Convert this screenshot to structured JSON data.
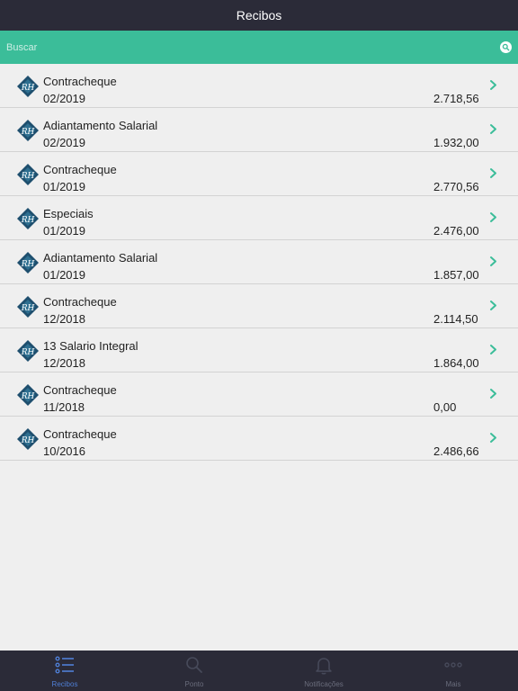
{
  "header": {
    "title": "Recibos"
  },
  "search": {
    "placeholder": "Buscar"
  },
  "receipts": [
    {
      "title": "Contracheque",
      "date": "02/2019",
      "value": "2.718,56"
    },
    {
      "title": "Adiantamento Salarial",
      "date": "02/2019",
      "value": "1.932,00"
    },
    {
      "title": "Contracheque",
      "date": "01/2019",
      "value": "2.770,56"
    },
    {
      "title": "Especiais",
      "date": "01/2019",
      "value": "2.476,00"
    },
    {
      "title": "Adiantamento Salarial",
      "date": "01/2019",
      "value": "1.857,00"
    },
    {
      "title": "Contracheque",
      "date": "12/2018",
      "value": "2.114,50"
    },
    {
      "title": "13 Salario Integral",
      "date": "12/2018",
      "value": "1.864,00"
    },
    {
      "title": "Contracheque",
      "date": "11/2018",
      "value": "0,00"
    },
    {
      "title": "Contracheque",
      "date": "10/2016",
      "value": "2.486,66"
    }
  ],
  "tabs": [
    {
      "label": "Recibos",
      "icon": "list-icon",
      "active": true
    },
    {
      "label": "Ponto",
      "icon": "search-icon",
      "active": false
    },
    {
      "label": "Notificações",
      "icon": "bell-icon",
      "active": false
    },
    {
      "label": "Mais",
      "icon": "more-icon",
      "active": false
    }
  ],
  "colors": {
    "nav_background": "#2b2b38",
    "search_background": "#3bbd99",
    "accent": "#3bbd99",
    "tab_active": "#4f7fd6",
    "tab_inactive": "#474a5a",
    "logo": "#1e4f6e"
  }
}
